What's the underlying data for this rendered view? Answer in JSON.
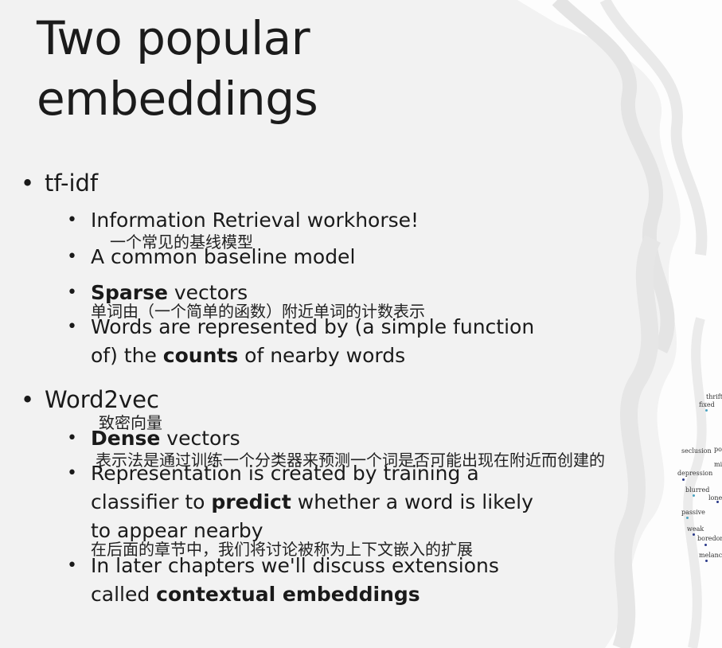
{
  "slide": {
    "title_line1": "Two popular",
    "title_line2": "embeddings",
    "bullet_glyph": "•",
    "tfidf": {
      "label": "tf-idf",
      "items": [
        {
          "text": "Information Retrieval workhorse!"
        },
        {
          "annotation": "一个常见的基线模型",
          "text": "A common baseline model"
        },
        {
          "bold": "Sparse",
          "rest": " vectors"
        },
        {
          "annotation": "单词由（一个简单的函数）附近单词的计数表示",
          "line1": "Words are represented by (a simple function",
          "line2_pre": "of) the ",
          "line2_bold": "counts",
          "line2_post": " of nearby words"
        }
      ]
    },
    "word2vec": {
      "label": "Word2vec",
      "items": [
        {
          "annotation": "致密向量",
          "bold": "Dense",
          "rest": " vectors"
        },
        {
          "annotation": "表示法是通过训练一个分类器来预测一个词是否可能出现在附近而创建的",
          "line1": "Representation is created by training a",
          "line2_pre": "classifier to ",
          "line2_bold": "predict",
          "line2_post": " whether a word is likely",
          "line3": "to appear nearby"
        },
        {
          "annotation": "在后面的章节中，我们将讨论被称为上下文嵌入的扩展",
          "line1": "In later chapters we'll discuss extensions",
          "line2_pre": "called  ",
          "line2_bold": "contextual embeddings"
        }
      ]
    },
    "side_figure": {
      "words": [
        "thrifty",
        "fixed",
        "seclusion",
        "pov",
        "depression",
        "mi",
        "blurred",
        "lonel",
        "passive",
        "weak",
        "boredom",
        "melanch"
      ]
    }
  }
}
